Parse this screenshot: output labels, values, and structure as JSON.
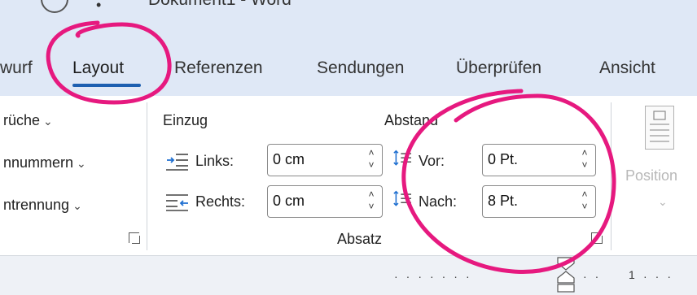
{
  "window": {
    "title": "Dokument1 - Word"
  },
  "tabs": [
    {
      "label": "wurf",
      "active": false
    },
    {
      "label": "Layout",
      "active": true
    },
    {
      "label": "Referenzen",
      "active": false
    },
    {
      "label": "Sendungen",
      "active": false
    },
    {
      "label": "Überprüfen",
      "active": false
    },
    {
      "label": "Ansicht",
      "active": false
    }
  ],
  "ribbon": {
    "page_setup": {
      "items": [
        {
          "label": "rüche",
          "icon": "chevron-down-icon"
        },
        {
          "label": "nnummern",
          "icon": "chevron-down-icon"
        },
        {
          "label": "ntrennung",
          "icon": "chevron-down-icon"
        }
      ]
    },
    "paragraph": {
      "group_label": "Absatz",
      "indent": {
        "heading": "Einzug",
        "left_label": "Links:",
        "left_value": "0 cm",
        "right_label": "Rechts:",
        "right_value": "0 cm"
      },
      "spacing": {
        "heading": "Abstand",
        "before_label": "Vor:",
        "before_value": "0 Pt.",
        "after_label": "Nach:",
        "after_value": "8 Pt."
      }
    },
    "arrange": {
      "position_label": "Position"
    }
  },
  "ruler": {
    "number": "1"
  },
  "colors": {
    "annotation": "#e6197f",
    "tab_underline": "#1d5fb0",
    "indent_icon": "#1e6fd0"
  }
}
